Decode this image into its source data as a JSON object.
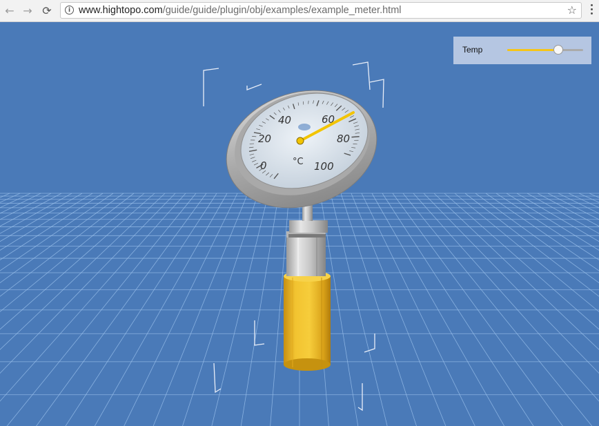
{
  "browser": {
    "url_host": "www.hightopo.com",
    "url_path": "/guide/guide/plugin/obj/examples/example_meter.html"
  },
  "panel": {
    "label": "Temp",
    "slider_fraction": 0.67
  },
  "gauge": {
    "tick_labels": [
      "0",
      "20",
      "40",
      "60",
      "80",
      "100"
    ],
    "unit": "°C",
    "needle_value": 67
  },
  "colors": {
    "background": "#4a7ab8",
    "accent": "#f5c518",
    "grid": "#9ec4ee"
  },
  "icons": [
    "back-arrow-icon",
    "forward-arrow-icon",
    "reload-icon",
    "info-icon",
    "star-icon",
    "menu-icon"
  ]
}
